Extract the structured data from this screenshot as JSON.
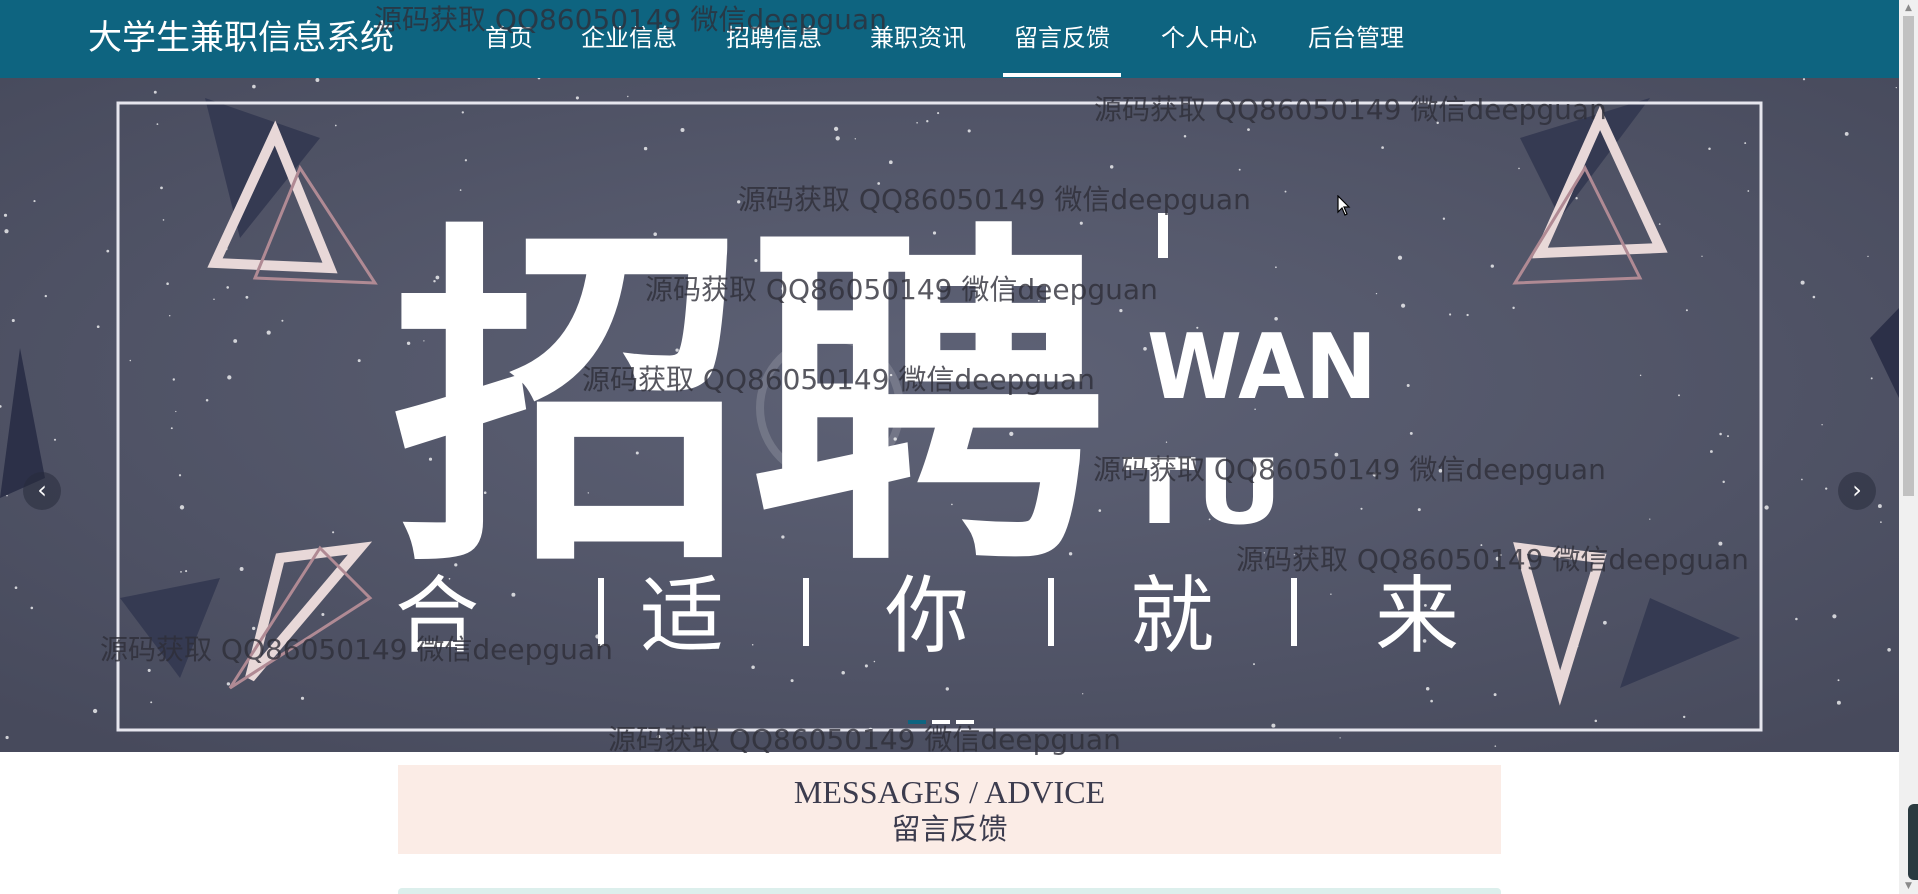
{
  "header": {
    "brand": "大学生兼职信息系统",
    "nav": [
      {
        "label": "首页"
      },
      {
        "label": "企业信息"
      },
      {
        "label": "招聘信息"
      },
      {
        "label": "兼职资讯"
      },
      {
        "label": "留言反馈",
        "active": true
      },
      {
        "label": "个人中心"
      },
      {
        "label": "后台管理"
      }
    ],
    "colors": {
      "bar": "#0e6480",
      "text": "#ffffff"
    }
  },
  "banner": {
    "headline": "招聘",
    "side_text_1": "WAN",
    "side_text_2": "TU",
    "tagline": [
      "合",
      "适",
      "你",
      "就",
      "来"
    ],
    "prev_icon": "chevron-left-icon",
    "next_icon": "chevron-right-icon",
    "indicator_count": 3,
    "active_indicator": 1,
    "colors": {
      "background": "#54586c",
      "frame": "#e6e6ee"
    }
  },
  "watermarks": {
    "text": "源码获取 QQ86050149 微信deepguan",
    "count": 9
  },
  "section": {
    "title_en": "MESSAGES / ADVICE",
    "title_zh": "留言反馈",
    "colors": {
      "background": "#fbece6",
      "text": "#3c3c4e"
    }
  }
}
